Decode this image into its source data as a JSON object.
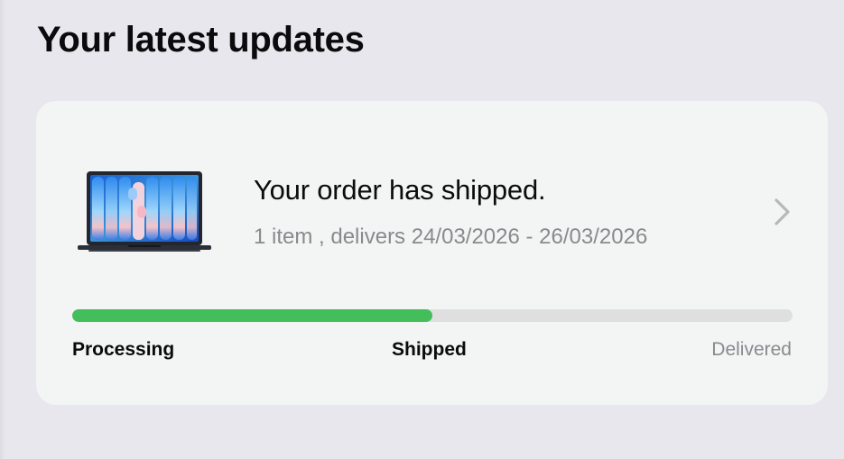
{
  "section": {
    "title": "Your latest updates"
  },
  "order": {
    "headline": "Your order has shipped.",
    "summary": "1 item , delivers 24/03/2026 - 26/03/2026",
    "image": "laptop-product-image",
    "action_icon": "chevron-right-icon",
    "progress": {
      "fraction": 0.5,
      "fill_color": "#44be5b",
      "track_color": "#dfdfe0",
      "steps": [
        {
          "label": "Processing",
          "state": "complete"
        },
        {
          "label": "Shipped",
          "state": "current"
        },
        {
          "label": "Delivered",
          "state": "pending"
        }
      ]
    }
  }
}
